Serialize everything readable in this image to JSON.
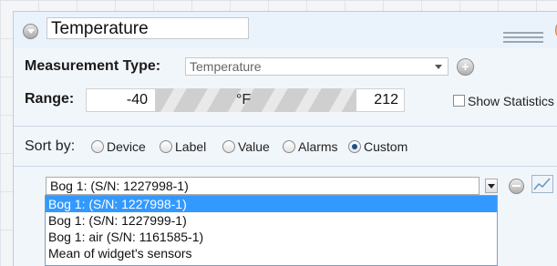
{
  "header": {
    "title_value": "Temperature",
    "icons": {
      "collapse": "collapse-icon",
      "drag": "drag-handle-icon",
      "close": "close-icon"
    }
  },
  "measurement": {
    "label": "Measurement Type:",
    "selected": "Temperature"
  },
  "range": {
    "label": "Range:",
    "min": "-40",
    "unit": "°F",
    "max": "212"
  },
  "statistics": {
    "label": "Show Statistics",
    "checked": false
  },
  "sort": {
    "label": "Sort by:",
    "options": [
      {
        "label": "Device",
        "checked": false
      },
      {
        "label": "Label",
        "checked": false
      },
      {
        "label": "Value",
        "checked": false
      },
      {
        "label": "Alarms",
        "checked": false
      },
      {
        "label": "Custom",
        "checked": true
      }
    ]
  },
  "sensor": {
    "selected": "Bog 1: (S/N: 1227998-1)",
    "options": [
      "Bog 1: (S/N: 1227998-1)",
      "Bog 1: (S/N: 1227999-1)",
      "Bog 1: air (S/N: 1161585-1)",
      "Mean of widget's sensors"
    ],
    "highlighted_index": 0
  },
  "colors": {
    "accent": "#3399ff",
    "header_bg": "#eaf3fb",
    "close_button": "#f19b5a"
  }
}
